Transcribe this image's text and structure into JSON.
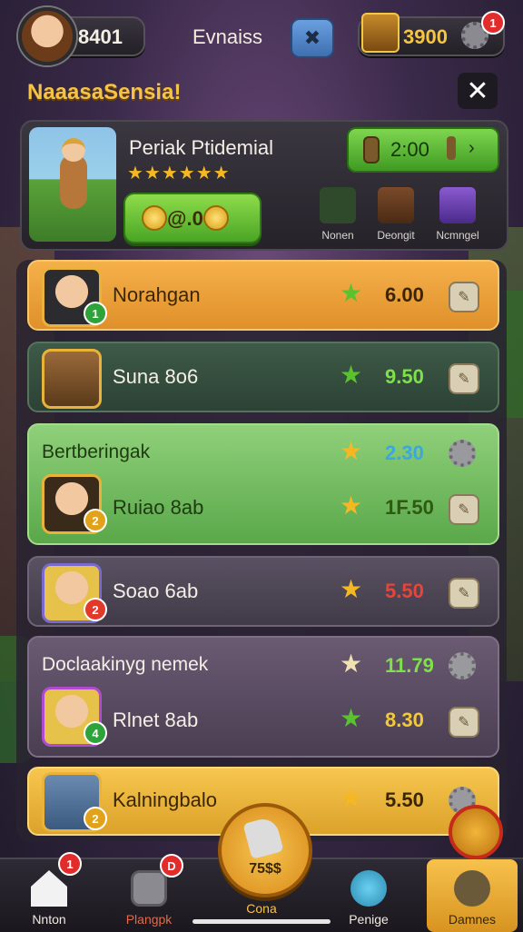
{
  "header": {
    "player_score": "8401",
    "title": "Evnaiss",
    "tool_icon": "wrench-icon",
    "gold": "3900",
    "gold_notification": "1"
  },
  "section": {
    "title": "NaaasaSensia!",
    "close_icon": "close-icon"
  },
  "featured": {
    "title": "Periak Ptidemial",
    "stars": "★★★★★★",
    "buy_label": "@.00",
    "timer": "2:00",
    "tabs": [
      {
        "label": "Nonen",
        "icon": "green-blob-icon"
      },
      {
        "label": "Deongit",
        "icon": "hero-portrait-icon"
      },
      {
        "label": "Ncmngel",
        "icon": "purple-scroll-icon"
      }
    ]
  },
  "list": {
    "rows": [
      {
        "name": "Norahgan",
        "price": "6.00",
        "star_color": "#5ac22e",
        "badge": "1",
        "badge_color": "#2ea33a",
        "price_color": "#f3c93a"
      },
      {
        "name": "Suna 8o6",
        "price": "9.50",
        "star_color": "#5ac22e",
        "badge": "",
        "badge_color": "",
        "price_color": "#7ee04a"
      },
      {
        "name": "Ruiao 8ab",
        "price": "1F.50",
        "star_color": "#f5b823",
        "badge": "2",
        "badge_color": "#e2a21a",
        "price_color": "#f3c93a"
      },
      {
        "name": "Soao 6ab",
        "price": "5.50",
        "star_color": "#f5b823",
        "badge": "2",
        "badge_color": "#e23a2a",
        "price_color": "#e8443a"
      },
      {
        "name": "Rlnet 8ab",
        "price": "8.30",
        "star_color": "#5ac22e",
        "badge": "4",
        "badge_color": "#2ea33a",
        "price_color": "#f3c93a"
      },
      {
        "name": "Kalningbalo",
        "price": "5.50",
        "star_color": "#f5b823",
        "badge": "2",
        "badge_color": "#e2a21a",
        "price_color": "#3b2604"
      }
    ],
    "subheads": [
      {
        "title": "Bertberingak",
        "price": "2.30",
        "price_color": "#3ba7e0"
      },
      {
        "title": "Doclaakinyg nemek",
        "price": "11.79",
        "price_color": "#7ee04a"
      }
    ]
  },
  "nav": {
    "items": [
      {
        "label": "Nnton",
        "icon": "home-icon",
        "badge": "1"
      },
      {
        "label": "Plangpk",
        "icon": "square-icon",
        "badge": "D"
      },
      {
        "label": "Cona",
        "icon": "horn-icon",
        "value": "75$$"
      },
      {
        "label": "Penige",
        "icon": "chat-bubble-icon"
      },
      {
        "label": "Damnes",
        "icon": "character-icon"
      }
    ]
  }
}
